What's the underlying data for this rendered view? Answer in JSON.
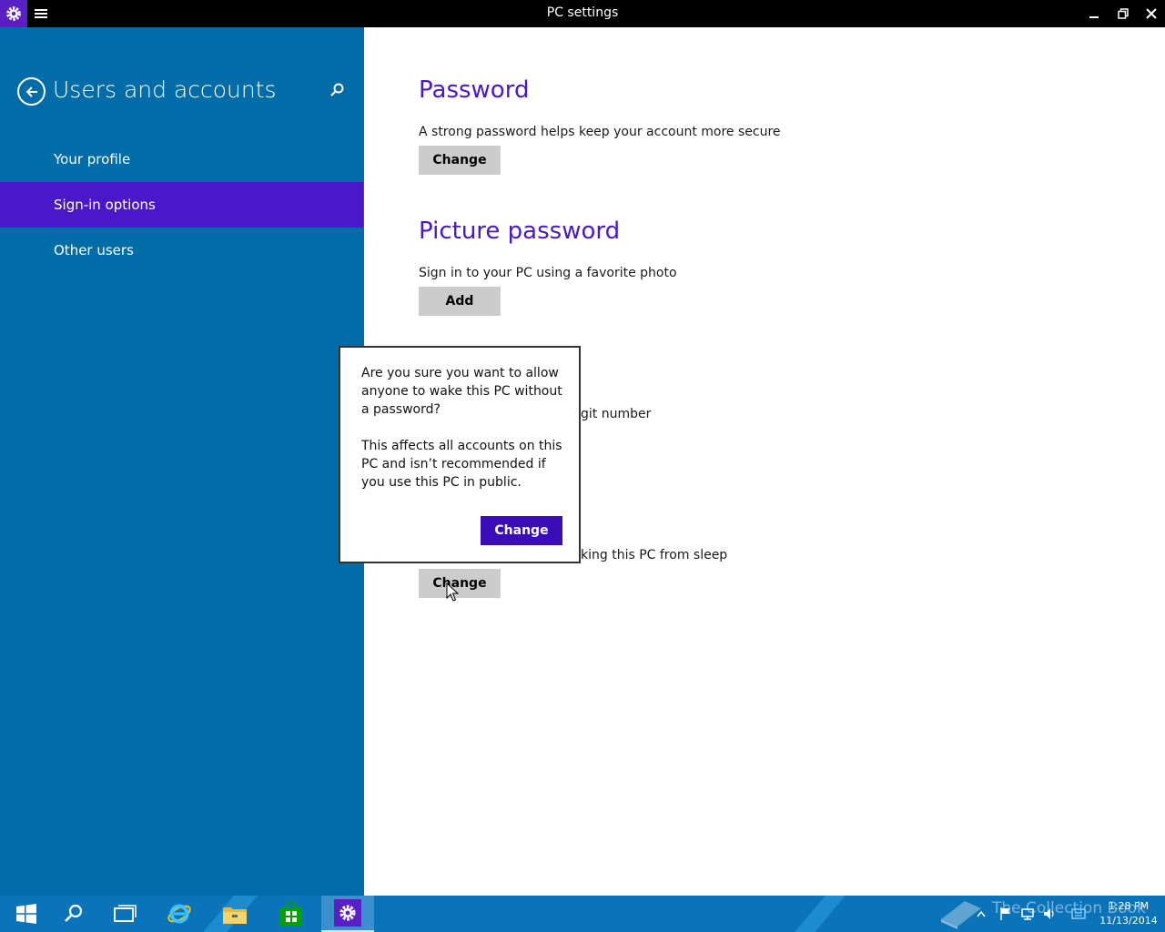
{
  "window": {
    "title": "PC settings",
    "minimize": "−",
    "restore": "❐",
    "close": "✕"
  },
  "sidebar": {
    "title": "Users and accounts",
    "items": [
      {
        "label": "Your profile",
        "selected": false
      },
      {
        "label": "Sign-in options",
        "selected": true
      },
      {
        "label": "Other users",
        "selected": false
      }
    ]
  },
  "main": {
    "password": {
      "heading": "Password",
      "description": "A strong password helps keep your account more secure",
      "button": "Change"
    },
    "picture_password": {
      "heading": "Picture password",
      "description": "Sign in to your PC using a favorite photo",
      "button": "Add"
    },
    "pin": {
      "description_visible": "git number"
    },
    "password_policy": {
      "description_visible": "king this PC from sleep",
      "button": "Change"
    }
  },
  "flyout": {
    "question": "Are you sure you want to allow anyone to wake this PC without a password?",
    "details": "This affects all accounts on this PC and isn’t recommended if you use this PC in public.",
    "confirm_button": "Change"
  },
  "taskbar": {
    "watermark": "The Collection Book",
    "time": "1:28 PM",
    "date": "11/13/2014"
  },
  "colors": {
    "accent": "#4a18c8",
    "sidebar_bg": "#026ca8",
    "taskbar_bg": "#0b74b8"
  }
}
